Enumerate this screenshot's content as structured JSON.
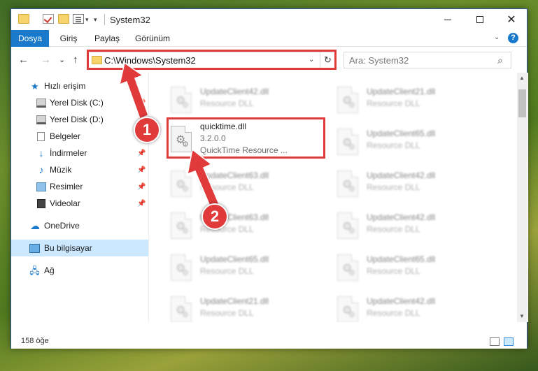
{
  "window": {
    "title": "System32",
    "controls": {
      "minimize_icon": "minimize-icon",
      "maximize_icon": "maximize-icon",
      "close_glyph": "✕"
    }
  },
  "ribbon": {
    "tabs": [
      "Dosya",
      "Giriş",
      "Paylaş",
      "Görünüm"
    ],
    "help_glyph": "?"
  },
  "address_bar": {
    "path": "C:\\Windows\\System32",
    "refresh_glyph": "↻",
    "search_placeholder": "Ara: System32"
  },
  "nav": {
    "back_glyph": "←",
    "forward_glyph": "→",
    "recent_glyph": "⌄",
    "up_glyph": "↑"
  },
  "sidebar": {
    "items": [
      {
        "label": "Hızlı erişim",
        "icon": "star-icon"
      },
      {
        "label": "Yerel Disk (C:)",
        "icon": "drive-icon"
      },
      {
        "label": "Yerel Disk (D:)",
        "icon": "drive-icon"
      },
      {
        "label": "Belgeler",
        "icon": "documents-icon"
      },
      {
        "label": "İndirmeler",
        "icon": "download-icon"
      },
      {
        "label": "Müzik",
        "icon": "music-icon"
      },
      {
        "label": "Resimler",
        "icon": "pictures-icon"
      },
      {
        "label": "Videolar",
        "icon": "videos-icon"
      },
      {
        "label": "OneDrive",
        "icon": "cloud-icon"
      },
      {
        "label": "Bu bilgisayar",
        "icon": "computer-icon"
      },
      {
        "label": "Ağ",
        "icon": "network-icon"
      }
    ],
    "pin_glyph": "📌"
  },
  "files": {
    "highlighted": {
      "name": "quicktime.dll",
      "version": "3.2.0.0",
      "description": "QuickTime Resource ..."
    },
    "blurred": [
      {
        "name": "UpdateClient42.dll",
        "type": "Resource DLL"
      },
      {
        "name": "UpdateClient21.dll",
        "type": "Resource DLL"
      },
      {
        "name": "UpdateClient65.dll",
        "type": "Resource DLL"
      },
      {
        "name": "UpdateClient63.dll",
        "type": "Resource DLL"
      },
      {
        "name": "UpdateClient42.dll",
        "type": "Resource DLL"
      },
      {
        "name": "UpdateClient63.dll",
        "type": "Resource DLL"
      },
      {
        "name": "UpdateClient42.dll",
        "type": "Resource DLL"
      },
      {
        "name": "UpdateClient65.dll",
        "type": "Resource DLL"
      },
      {
        "name": "UpdateClient65.dll",
        "type": "Resource DLL"
      },
      {
        "name": "UpdateClient21.dll",
        "type": "Resource DLL"
      },
      {
        "name": "UpdateClient42.dll",
        "type": "Resource DLL"
      }
    ]
  },
  "status": {
    "item_count": "158 öğe"
  },
  "annotations": {
    "step1": "1",
    "step2": "2",
    "color": "#e03a3a"
  }
}
